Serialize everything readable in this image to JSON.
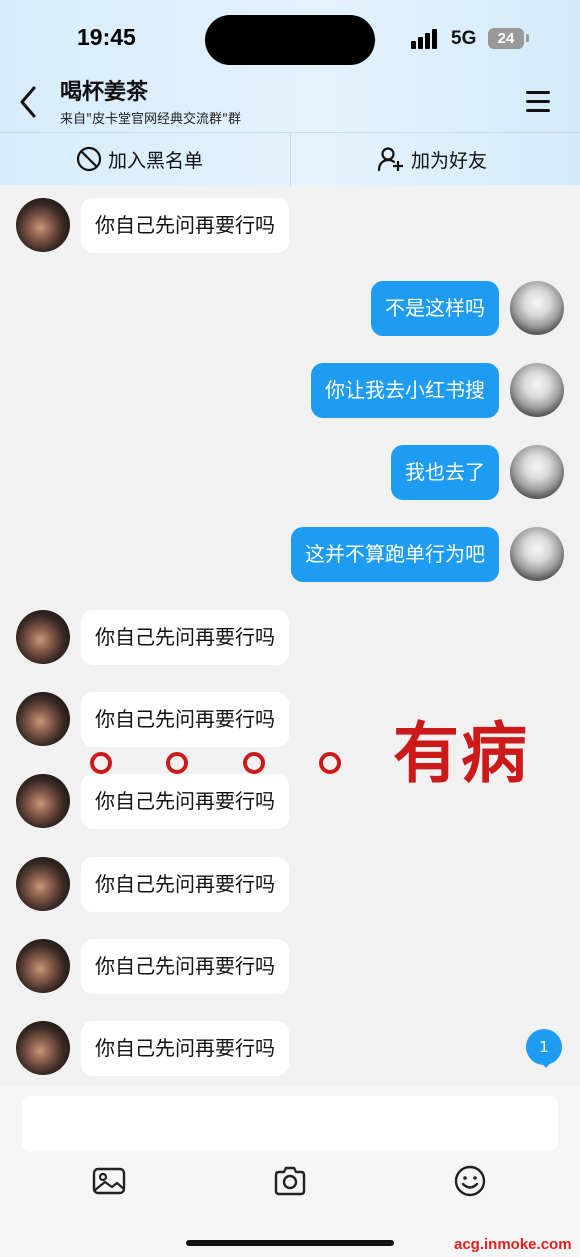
{
  "status_bar": {
    "time": "19:45",
    "network": "5G",
    "battery": "24"
  },
  "header": {
    "title": "喝杯姜茶",
    "subtitle": "来自\"皮卡堂官网经典交流群\"群"
  },
  "actions": {
    "blacklist_label": "加入黑名单",
    "add_friend_label": "加为好友"
  },
  "messages": [
    {
      "sender": "other",
      "text": "你自己先问再要行吗"
    },
    {
      "sender": "self",
      "text": "不是这样吗"
    },
    {
      "sender": "self",
      "text": "你让我去小红书搜"
    },
    {
      "sender": "self",
      "text": "我也去了"
    },
    {
      "sender": "self",
      "text": "这并不算跑单行为吧"
    },
    {
      "sender": "other",
      "text": "你自己先问再要行吗"
    },
    {
      "sender": "other",
      "text": "你自己先问再要行吗"
    },
    {
      "sender": "other",
      "text": "你自己先问再要行吗"
    },
    {
      "sender": "other",
      "text": "你自己先问再要行吗"
    },
    {
      "sender": "other",
      "text": "你自己先问再要行吗"
    },
    {
      "sender": "other",
      "text": "你自己先问再要行吗"
    }
  ],
  "overlay": {
    "text": "有病"
  },
  "unread_count": "1",
  "input": {
    "value": "",
    "placeholder": ""
  },
  "toolbar_icons": [
    "image-icon",
    "camera-icon",
    "emoji-icon"
  ],
  "watermark": "acg.inmoke.com",
  "colors": {
    "accent": "#1e9cf2",
    "overlay_red": "#cc1a1a",
    "header_bg": "#d7ecfb",
    "chat_bg": "#f1f1f1"
  }
}
